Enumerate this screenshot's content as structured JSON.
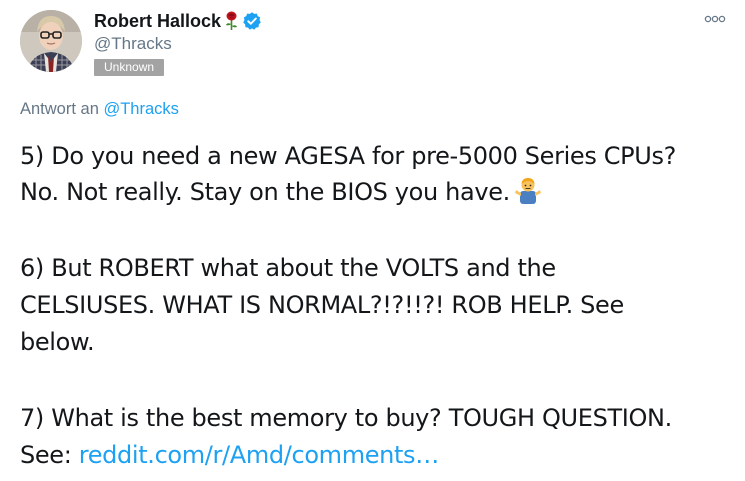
{
  "author": {
    "name": "Robert Hallock",
    "handle": "@Thracks",
    "badge": "Unknown"
  },
  "icons": {
    "name_emoji": "rose-icon",
    "verified": "verified-icon",
    "menu": "more-options-icon",
    "shrug": "man-shrugging-emoji-icon"
  },
  "reply": {
    "prefix": "Antwort an",
    "handle": "@Thracks"
  },
  "tweet": {
    "line1": "5) Do you need a new AGESA for pre-5000 Series CPUs?",
    "line2": "No. Not really. Stay on the BIOS you have.",
    "line3": "6) But ROBERT what about the VOLTS and the",
    "line4": "CELSIUSES. WHAT IS NORMAL?!?!!?! ROB HELP. See",
    "line5": "below.",
    "line6": "7) What is the best memory to buy? TOUGH QUESTION.",
    "line7_prefix": "See:",
    "link": "reddit.com/r/Amd/comments…"
  },
  "colors": {
    "link": "#1da1f2",
    "secondary_text": "#657786",
    "primary_text": "#14171a",
    "badge_bg": "#a3a3a3",
    "verified": "#1da1f2"
  }
}
